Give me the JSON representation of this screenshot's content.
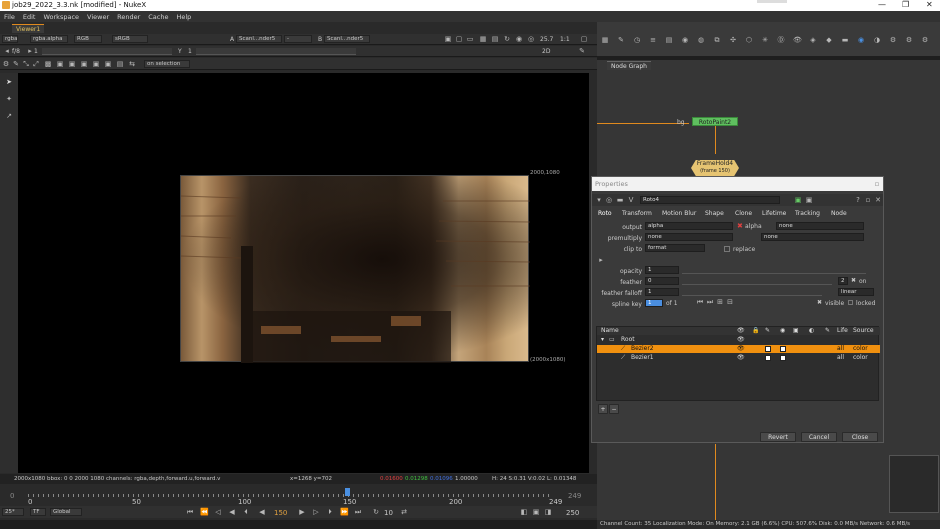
{
  "window": {
    "title": "job29_2022_3.3.nk [modified] - NukeX",
    "minimize": "—",
    "maximize": "❐",
    "close": "✕"
  },
  "menu": [
    "File",
    "Edit",
    "Workspace",
    "Viewer",
    "Render",
    "Cache",
    "Help"
  ],
  "viewer": {
    "tab": "Viewer1",
    "channels": "rgba",
    "alpha": "rgba.alpha",
    "colorspace": "RGB",
    "lut": "sRGB",
    "input_a": "Scanl...nder5",
    "input_b": "Scanl...nder5",
    "a_label": "A",
    "b_label": "B",
    "dash": "-",
    "zoom": "25.7",
    "ratio": "1:1",
    "view_mode": "2D",
    "fstop": "f/8",
    "frame_field": "1",
    "y_label": "Y",
    "y_value": "1",
    "overlay_mode": "on selection",
    "format_tr": "2000,1080",
    "format_br": "(2000x1080)"
  },
  "status_bar": {
    "info": "2000x1080  bbox: 0 0 2000 1080 channels: rgba,depth,forward.u,forward.v",
    "coords": "x=1268 y=702",
    "r": "0.01600",
    "g": "0.01298",
    "b": "0.01096",
    "a": "1.00000",
    "hsvl": "H: 24 S:0.31 V:0.02  L: 0.01348"
  },
  "timeline": {
    "ticks": [
      "0",
      "50",
      "100",
      "150",
      "200",
      "249"
    ],
    "start": "0",
    "end": "249",
    "current": "150",
    "fps": "25*",
    "tf": "TF",
    "global": "Global",
    "step": "10",
    "end_field": "250"
  },
  "node_graph": {
    "tab": "Node Graph",
    "node_rotopaint": "RotoPaint2",
    "node_framehold": "FrameHold4",
    "node_framehold_sub": "(frame 150)",
    "bg_label": "bg"
  },
  "properties": {
    "title": "Properties",
    "node_name": "Roto4",
    "tabs": [
      "Roto",
      "Transform",
      "Motion Blur",
      "Shape",
      "Clone",
      "Lifetime",
      "Tracking",
      "Node"
    ],
    "output_label": "output",
    "output_value": "alpha",
    "output_alpha": "alpha",
    "output_none": "none",
    "premultiply_label": "premultiply",
    "premultiply_value": "none",
    "premultiply_right": "none",
    "clip_label": "clip to",
    "clip_value": "format",
    "replace_label": "replace",
    "opacity_label": "opacity",
    "opacity_value": "1",
    "feather_label": "feather",
    "feather_value": "0",
    "feather_extra": "2",
    "feather_on": "on",
    "falloff_label": "feather falloff",
    "falloff_value": "1",
    "falloff_mode": "linear",
    "spline_label": "spline key",
    "spline_value": "1",
    "spline_of": "of 1",
    "visible_label": "visible",
    "locked_label": "locked",
    "tree_cols": [
      "Name",
      "Life",
      "Source"
    ],
    "tree_rows": [
      {
        "name": "Root",
        "life": "",
        "source": ""
      },
      {
        "name": "Bezier2",
        "life": "all",
        "source": "color"
      },
      {
        "name": "Bezier1",
        "life": "all",
        "source": "color"
      }
    ],
    "revert": "Revert",
    "cancel": "Cancel",
    "close": "Close",
    "add": "+",
    "remove": "−"
  },
  "bottom_status": "Channel Count: 35  Localization Mode: On  Memory: 2.1 GB (6.6%)  CPU: 507.6%  Disk: 0.0 MB/s  Network: 0.6 MB/s"
}
